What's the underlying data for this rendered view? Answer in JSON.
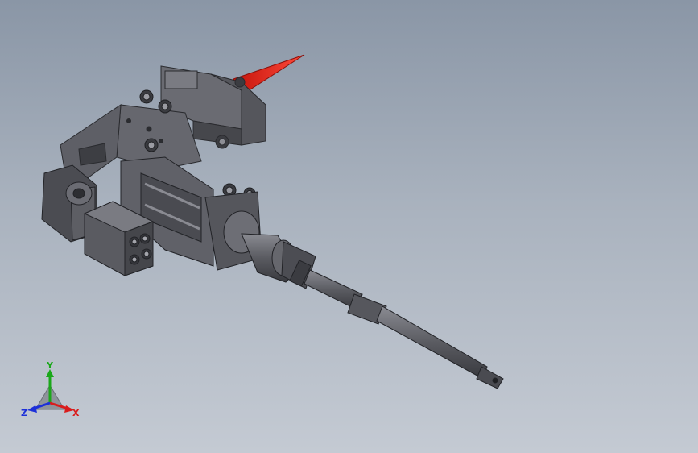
{
  "viewport": {
    "background_top": "#8a96a6",
    "background_bottom": "#c4cad3"
  },
  "model": {
    "part_color": "#5b5c63",
    "part_dark": "#3a3b40",
    "part_light": "#7b7c84",
    "highlight_color": "#e8241a"
  },
  "triad": {
    "x_label": "X",
    "y_label": "Y",
    "z_label": "Z",
    "x_color": "#d91c1c",
    "y_color": "#1aa81a",
    "z_color": "#1c2fd9"
  }
}
